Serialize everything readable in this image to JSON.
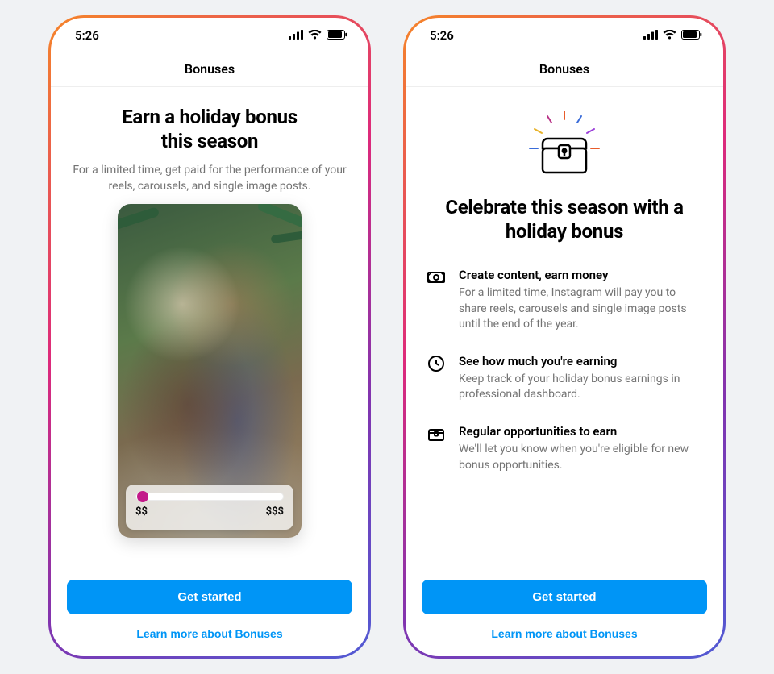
{
  "status": {
    "time": "5:26"
  },
  "screen1": {
    "nav_title": "Bonuses",
    "title_line1": "Earn a holiday bonus",
    "title_line2": "this season",
    "subtitle": "For a limited time, get paid for the performance of your reels, carousels, and single image posts.",
    "slider_min": "$$",
    "slider_max": "$$$",
    "cta_primary": "Get started",
    "cta_link": "Learn more about Bonuses"
  },
  "screen2": {
    "nav_title": "Bonuses",
    "title_line1": "Celebrate this season with a",
    "title_line2": "holiday bonus",
    "features": [
      {
        "title": "Create content, earn money",
        "desc": "For a limited time, Instagram will pay you to share reels, carousels and single image posts until the end of the year."
      },
      {
        "title": "See how much you're earning",
        "desc": "Keep track of your holiday bonus earnings in professional dashboard."
      },
      {
        "title": "Regular opportunities to earn",
        "desc": "We'll let you know when you're eligible for new bonus opportunities."
      }
    ],
    "cta_primary": "Get started",
    "cta_link": "Learn more about Bonuses"
  }
}
